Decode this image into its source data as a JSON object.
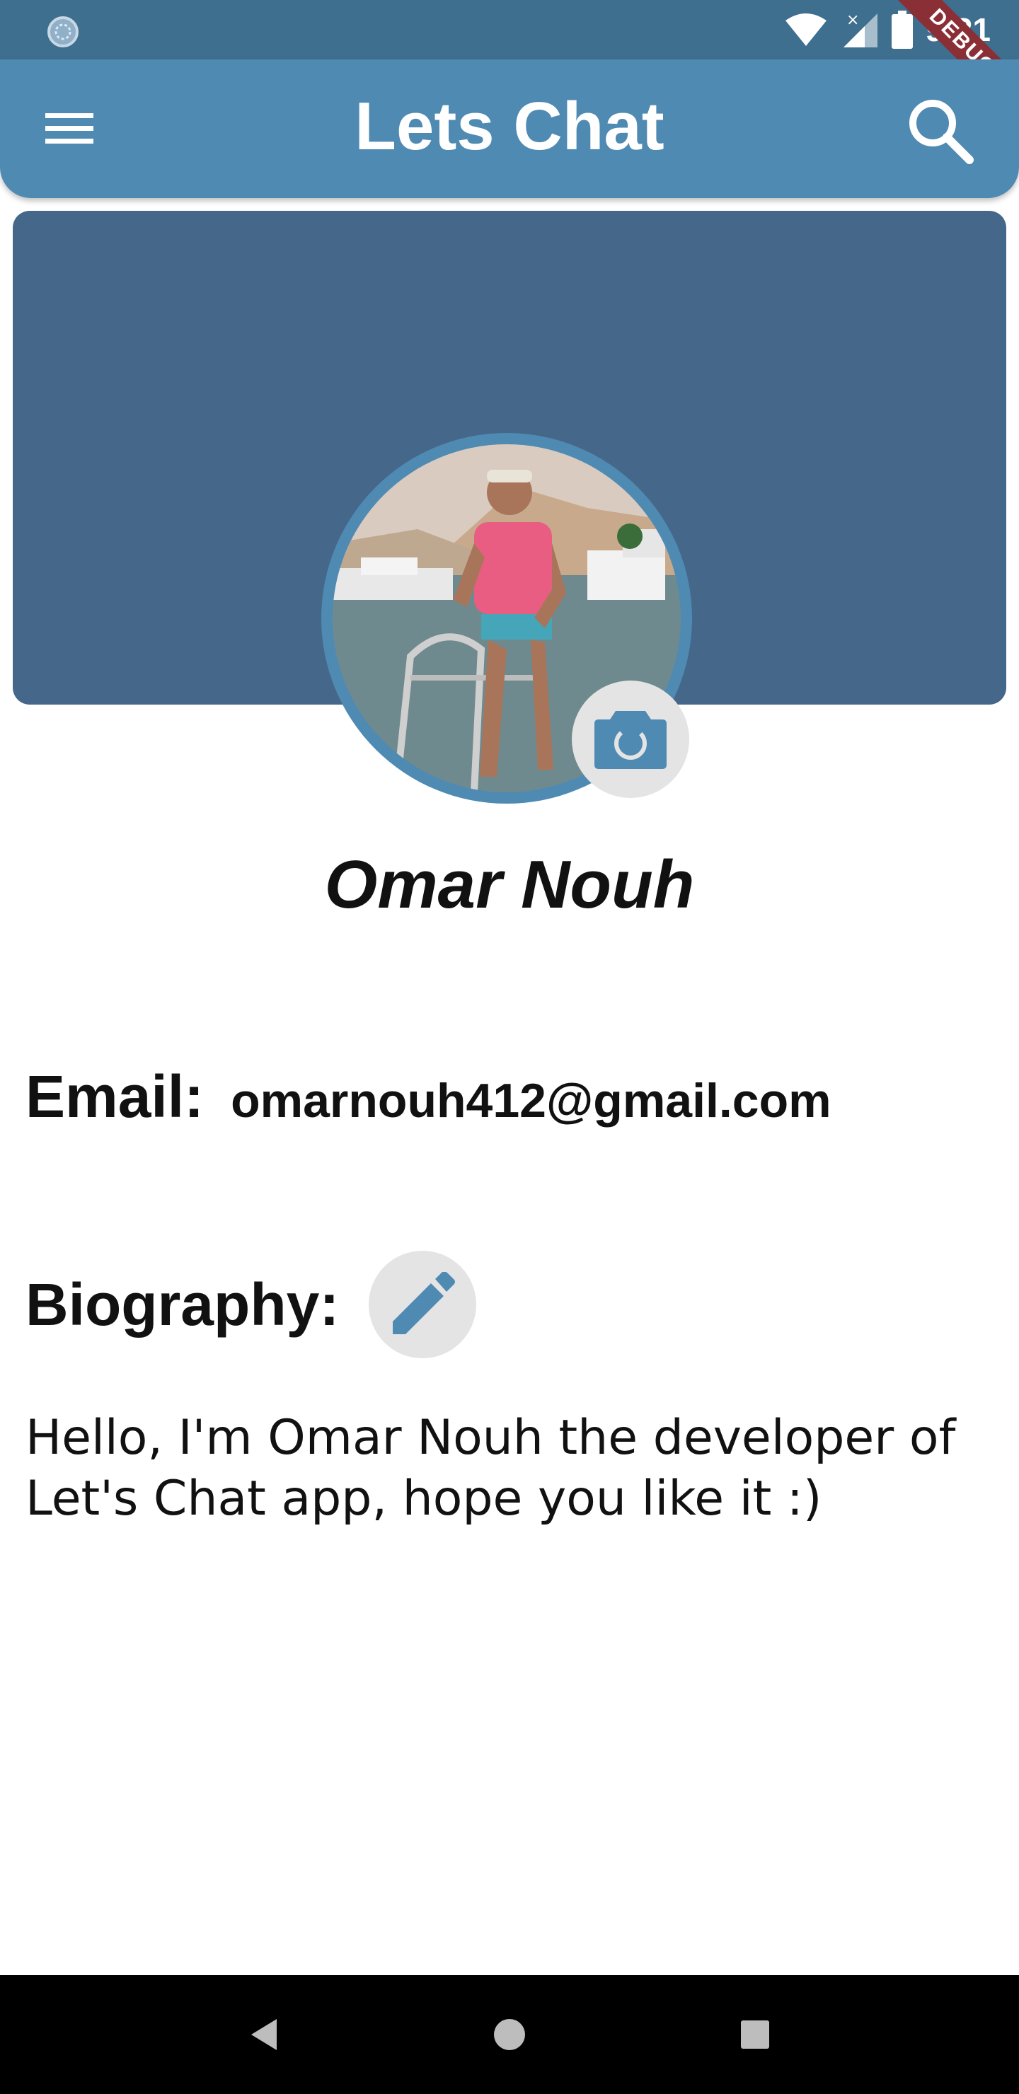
{
  "status_bar": {
    "time": "9:21",
    "debug_label": "DEBUG",
    "icons": [
      "loading-circle-icon",
      "wifi-icon",
      "signal-icon",
      "battery-icon"
    ]
  },
  "app_bar": {
    "title": "Lets Chat",
    "menu_icon": "hamburger-menu-icon",
    "search_icon": "search-icon",
    "color": "#4f8ab3"
  },
  "profile": {
    "cover_color": "#456789",
    "name": "Omar Nouh",
    "camera_icon": "camera-icon"
  },
  "email": {
    "label": "Email:",
    "value": "omarnouh412@gmail.com"
  },
  "biography": {
    "label": "Biography:",
    "edit_icon": "pencil-icon",
    "text": "Hello, I'm Omar Nouh the developer of Let's Chat app, hope you like it :)"
  },
  "nav_bar": {
    "icons": [
      "back-icon",
      "home-icon",
      "recents-icon"
    ]
  }
}
